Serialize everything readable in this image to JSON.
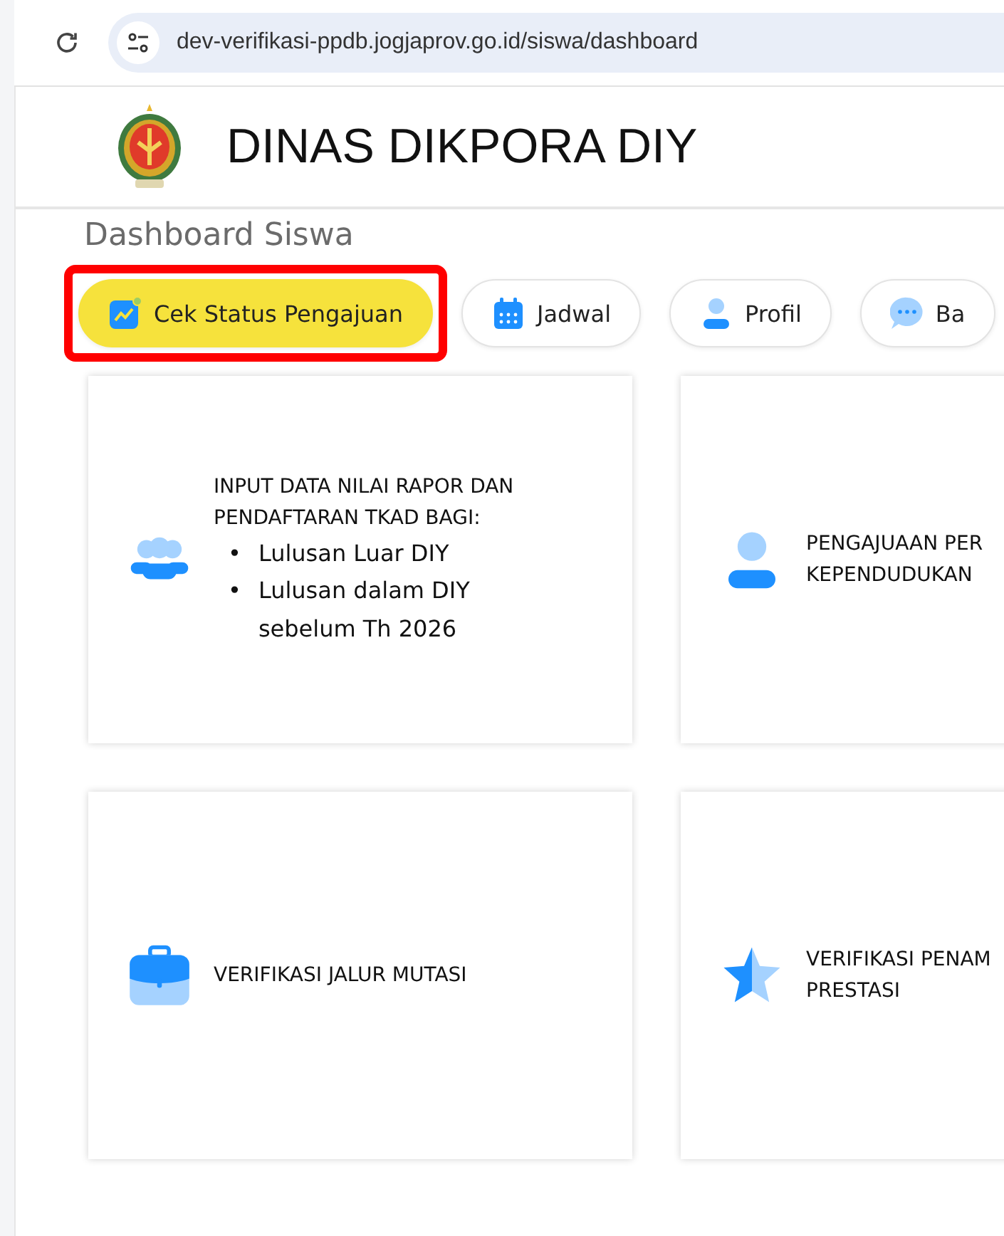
{
  "browser": {
    "url": "dev-verifikasi-ppdb.jogjaprov.go.id/siswa/dashboard"
  },
  "header": {
    "title": "DINAS DIKPORA DIY"
  },
  "page_title": "Dashboard Siswa",
  "nav_buttons": [
    {
      "label": "Cek Status Pengajuan",
      "selected": true,
      "highlighted": true
    },
    {
      "label": "Jadwal",
      "selected": false,
      "highlighted": false
    },
    {
      "label": "Profil",
      "selected": false,
      "highlighted": false
    },
    {
      "label": "Ba",
      "selected": false,
      "highlighted": false
    }
  ],
  "cards": [
    {
      "title_lines": [
        "INPUT DATA NILAI RAPOR DAN",
        "PENDAFTARAN TKAD BAGI:"
      ],
      "items": [
        {
          "marker": "•",
          "text": "Lulusan Luar DIY"
        },
        {
          "marker": "•",
          "text": "Lulusan dalam DIY sebelum Th 2026"
        }
      ]
    },
    {
      "title_lines": [
        "PENGAJUAAN PER",
        "KEPENDUDUKAN"
      ]
    },
    {
      "title_lines": [
        "VERIFIKASI JALUR MUTASI"
      ]
    },
    {
      "title_lines": [
        "VERIFIKASI PENAM",
        "PRESTASI"
      ]
    }
  ]
}
